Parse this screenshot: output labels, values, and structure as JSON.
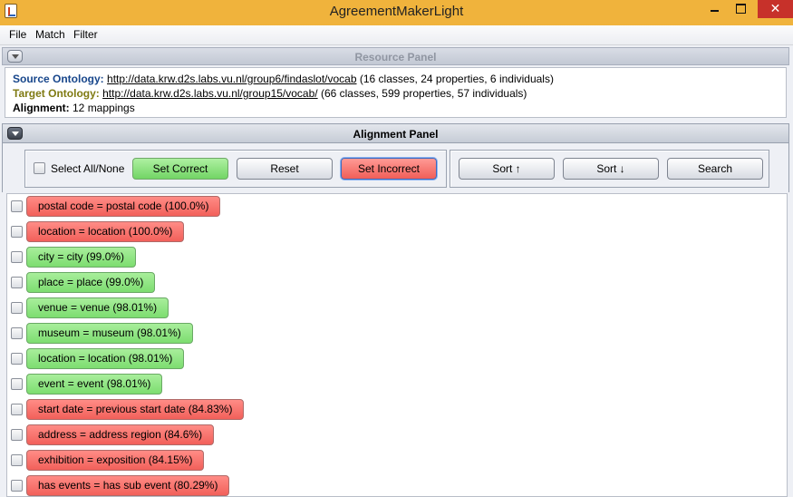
{
  "window": {
    "title": "AgreementMakerLight",
    "minimize_label": "",
    "maximize_label": "",
    "close_label": "✕"
  },
  "menu": {
    "items": [
      "File",
      "Match",
      "Filter"
    ]
  },
  "resource_panel": {
    "title": "Resource Panel",
    "source_label": "Source Ontology:",
    "source_url": "http://data.krw.d2s.labs.vu.nl/group6/findaslot/vocab",
    "source_info": " (16 classes, 24 properties, 6 individuals)",
    "target_label": "Target Ontology:",
    "target_url": "http://data.krw.d2s.labs.vu.nl/group15/vocab/",
    "target_info": " (66 classes, 599 properties, 57 individuals)",
    "alignment_label": "Alignment:",
    "alignment_info": " 12 mappings"
  },
  "alignment_panel": {
    "title": "Alignment Panel",
    "select_all_label": "Select All/None",
    "set_correct_label": "Set Correct",
    "reset_label": "Reset",
    "set_incorrect_label": "Set Incorrect",
    "sort_asc_label": "Sort ↑",
    "sort_desc_label": "Sort ↓",
    "search_label": "Search"
  },
  "colors": {
    "correct": "#7ddd70",
    "incorrect": "#f2605a",
    "titlebar": "#f0b33c"
  },
  "mappings": [
    {
      "label": "postal code = postal code (100.0%)",
      "status": "incorrect"
    },
    {
      "label": "location = location (100.0%)",
      "status": "incorrect"
    },
    {
      "label": "city = city (99.0%)",
      "status": "correct"
    },
    {
      "label": "place = place (99.0%)",
      "status": "correct"
    },
    {
      "label": "venue = venue (98.01%)",
      "status": "correct"
    },
    {
      "label": "museum = museum (98.01%)",
      "status": "correct"
    },
    {
      "label": "location = location (98.01%)",
      "status": "correct"
    },
    {
      "label": "event = event (98.01%)",
      "status": "correct"
    },
    {
      "label": "start date = previous start date (84.83%)",
      "status": "incorrect"
    },
    {
      "label": "address = address region (84.6%)",
      "status": "incorrect"
    },
    {
      "label": "exhibition = exposition (84.15%)",
      "status": "incorrect"
    },
    {
      "label": "has events = has sub event (80.29%)",
      "status": "incorrect"
    }
  ]
}
